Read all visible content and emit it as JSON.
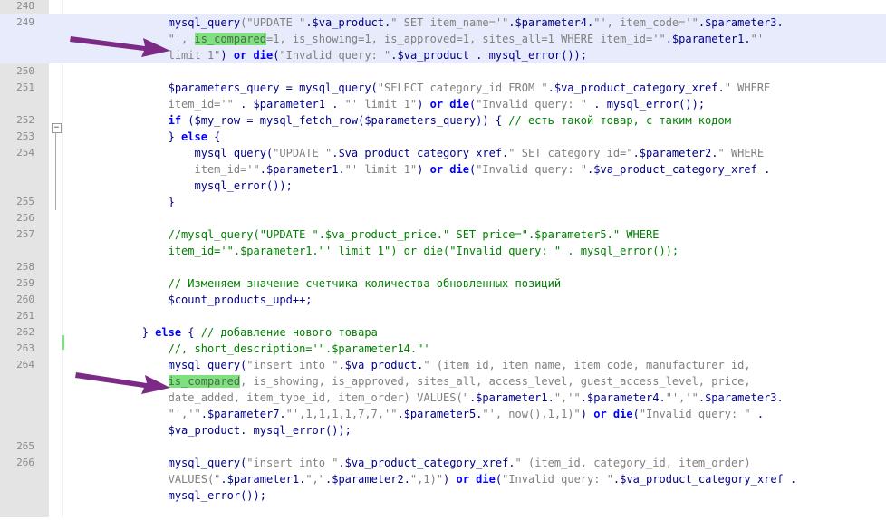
{
  "colors": {
    "keyword": "#0000ff",
    "string": "#808080",
    "variable": "#00008b",
    "comment": "#008000",
    "match_highlight": "#7fe07f",
    "line_highlight": "#e8ebfb",
    "arrow": "#7b2a86"
  },
  "icons": {
    "fold": "minus-box-icon",
    "arrow": "arrow-right-icon"
  },
  "lines": [
    {
      "n": "248",
      "segs": []
    },
    {
      "n": "249",
      "segs": [
        [
          "",
          "                "
        ],
        [
          "v",
          "mysql_query"
        ],
        [
          "s",
          "(\"UPDATE \""
        ],
        [
          "v",
          ".$va_product."
        ],
        [
          "s",
          "\" SET item_name='\""
        ],
        [
          "v",
          ".$parameter4."
        ],
        [
          "s",
          "\"', item_code='\""
        ],
        [
          "v",
          ".$parameter3."
        ]
      ]
    },
    {
      "n": "",
      "segs": [
        [
          "s",
          "                \"', "
        ],
        [
          "m",
          "is_compared"
        ],
        [
          "s",
          "=1, is_showing=1, is_approved=1, sites_all=1 WHERE item_id='\""
        ],
        [
          "v",
          ".$parameter1."
        ],
        [
          "s",
          "\"'"
        ]
      ]
    },
    {
      "n": "",
      "segs": [
        [
          "s",
          "                limit 1\""
        ],
        [
          "v",
          ") "
        ],
        [
          "k",
          "or die"
        ],
        [
          "v",
          "("
        ],
        [
          "s",
          "\"Invalid query: \""
        ],
        [
          "v",
          ".$va_product . mysql_error());"
        ]
      ]
    },
    {
      "n": "250",
      "segs": []
    },
    {
      "n": "251",
      "segs": [
        [
          "v",
          "                $parameters_query = mysql_query("
        ],
        [
          "s",
          "\"SELECT category_id FROM \""
        ],
        [
          "v",
          ".$va_product_category_xref."
        ],
        [
          "s",
          "\" WHERE"
        ]
      ]
    },
    {
      "n": "",
      "segs": [
        [
          "s",
          "                item_id='\""
        ],
        [
          "v",
          " . $parameter1 . "
        ],
        [
          "s",
          "\"' limit 1\""
        ],
        [
          "v",
          ") "
        ],
        [
          "k",
          "or die"
        ],
        [
          "v",
          "("
        ],
        [
          "s",
          "\"Invalid query: \""
        ],
        [
          "v",
          " . mysql_error());"
        ]
      ]
    },
    {
      "n": "252",
      "segs": [
        [
          "v",
          "                "
        ],
        [
          "k",
          "if"
        ],
        [
          "v",
          " ($my_row = mysql_fetch_row($parameters_query)) { "
        ],
        [
          "c",
          "// есть такой товар, с таким кодом"
        ]
      ]
    },
    {
      "n": "253",
      "segs": [
        [
          "v",
          "                } "
        ],
        [
          "k",
          "else"
        ],
        [
          "v",
          " {"
        ]
      ]
    },
    {
      "n": "254",
      "segs": [
        [
          "v",
          "                    mysql_query("
        ],
        [
          "s",
          "\"UPDATE \""
        ],
        [
          "v",
          ".$va_product_category_xref."
        ],
        [
          "s",
          "\" SET category_id=\""
        ],
        [
          "v",
          ".$parameter2."
        ],
        [
          "s",
          "\" WHERE"
        ]
      ]
    },
    {
      "n": "",
      "segs": [
        [
          "s",
          "                    item_id='\""
        ],
        [
          "v",
          ".$parameter1."
        ],
        [
          "s",
          "\"' limit 1\""
        ],
        [
          "v",
          ") "
        ],
        [
          "k",
          "or die"
        ],
        [
          "v",
          "("
        ],
        [
          "s",
          "\"Invalid query: \""
        ],
        [
          "v",
          ".$va_product_category_xref ."
        ]
      ]
    },
    {
      "n": "",
      "segs": [
        [
          "v",
          "                    mysql_error());"
        ]
      ]
    },
    {
      "n": "255",
      "segs": [
        [
          "v",
          "                }"
        ]
      ]
    },
    {
      "n": "256",
      "segs": []
    },
    {
      "n": "257",
      "segs": [
        [
          "c",
          "                //mysql_query(\"UPDATE \".$va_product_price.\" SET price=\".$parameter5.\" WHERE"
        ]
      ]
    },
    {
      "n": "",
      "segs": [
        [
          "c",
          "                item_id='\".$parameter1.\"' limit 1\") or die(\"Invalid query: \" . mysql_error());"
        ]
      ]
    },
    {
      "n": "258",
      "segs": []
    },
    {
      "n": "259",
      "segs": [
        [
          "c",
          "                // Изменяем значение счетчика количества обновленных позиций"
        ]
      ]
    },
    {
      "n": "260",
      "segs": [
        [
          "v",
          "                $count_products_upd++;"
        ]
      ]
    },
    {
      "n": "261",
      "segs": []
    },
    {
      "n": "262",
      "segs": [
        [
          "v",
          "            } "
        ],
        [
          "k",
          "else"
        ],
        [
          "v",
          " { "
        ],
        [
          "c",
          "// добавление нового товара"
        ]
      ]
    },
    {
      "n": "263",
      "segs": [
        [
          "c",
          "                //, short_description='\".$parameter14.\"'"
        ]
      ]
    },
    {
      "n": "264",
      "segs": [
        [
          "v",
          "                mysql_query("
        ],
        [
          "s",
          "\"insert into \""
        ],
        [
          "v",
          ".$va_product."
        ],
        [
          "s",
          "\" (item_id, item_name, item_code, manufacturer_id,"
        ]
      ]
    },
    {
      "n": "",
      "segs": [
        [
          "s",
          "                "
        ],
        [
          "m",
          "is_compared"
        ],
        [
          "s",
          ", is_showing, is_approved, sites_all, access_level, guest_access_level, price,"
        ]
      ]
    },
    {
      "n": "",
      "segs": [
        [
          "s",
          "                date_added, item_type_id, item_order) VALUES(\""
        ],
        [
          "v",
          ".$parameter1."
        ],
        [
          "s",
          "\",'\""
        ],
        [
          "v",
          ".$parameter4."
        ],
        [
          "s",
          "\"','\""
        ],
        [
          "v",
          ".$parameter3."
        ]
      ]
    },
    {
      "n": "",
      "segs": [
        [
          "s",
          "                \"','\""
        ],
        [
          "v",
          ".$parameter7."
        ],
        [
          "s",
          "\"',1,1,1,1,7,7,'\""
        ],
        [
          "v",
          ".$parameter5."
        ],
        [
          "s",
          "\"', now(),1,1)\""
        ],
        [
          "v",
          ") "
        ],
        [
          "k",
          "or die"
        ],
        [
          "v",
          "("
        ],
        [
          "s",
          "\"Invalid query: \""
        ],
        [
          "v",
          " ."
        ]
      ]
    },
    {
      "n": "",
      "segs": [
        [
          "v",
          "                $va_product. mysql_error());"
        ]
      ]
    },
    {
      "n": "265",
      "segs": []
    },
    {
      "n": "266",
      "segs": [
        [
          "v",
          "                mysql_query("
        ],
        [
          "s",
          "\"insert into \""
        ],
        [
          "v",
          ".$va_product_category_xref."
        ],
        [
          "s",
          "\" (item_id, category_id, item_order)"
        ]
      ]
    },
    {
      "n": "",
      "segs": [
        [
          "s",
          "                VALUES(\""
        ],
        [
          "v",
          ".$parameter1."
        ],
        [
          "s",
          "\",\""
        ],
        [
          "v",
          ".$parameter2."
        ],
        [
          "s",
          "\",1)\""
        ],
        [
          "v",
          ") "
        ],
        [
          "k",
          "or die"
        ],
        [
          "v",
          "("
        ],
        [
          "s",
          "\"Invalid query: \""
        ],
        [
          "v",
          ".$va_product_category_xref ."
        ]
      ]
    },
    {
      "n": "",
      "segs": [
        [
          "v",
          "                mysql_error());"
        ]
      ]
    },
    {
      "n": "",
      "segs": []
    }
  ]
}
